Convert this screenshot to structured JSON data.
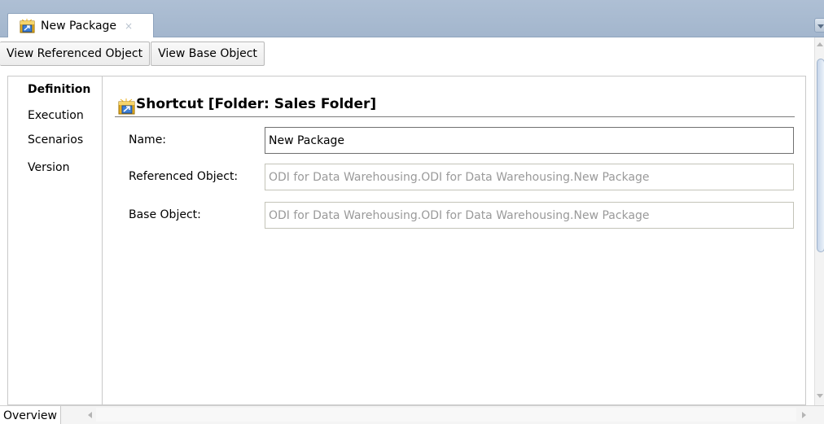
{
  "document_tab": {
    "label": "New Package",
    "close_glyph": "×",
    "icon": "package-shortcut-icon"
  },
  "toolbar": {
    "view_referenced_label": "View Referenced Object",
    "view_base_label": "View Base Object"
  },
  "side_nav": {
    "items": [
      {
        "label": "Definition",
        "active": true
      },
      {
        "label": "Execution",
        "active": false
      },
      {
        "label": "Scenarios",
        "active": false
      },
      {
        "label": "Version",
        "active": false
      }
    ]
  },
  "section": {
    "title": "Shortcut [Folder: Sales Folder]",
    "icon": "package-shortcut-icon"
  },
  "form": {
    "name_label": "Name:",
    "name_value": "New Package",
    "referenced_label": "Referenced Object:",
    "referenced_value": "ODI for Data Warehousing.ODI for Data Warehousing.New Package",
    "base_label": "Base Object:",
    "base_value": "ODI for Data Warehousing.ODI for Data Warehousing.New Package"
  },
  "bottom": {
    "overview_tab": "Overview"
  },
  "colors": {
    "tabstrip_bg": "#aebfd4",
    "readonly_text": "#9a9a9a",
    "icon_gold": "#e8b020",
    "icon_blue": "#3d7fd6"
  }
}
